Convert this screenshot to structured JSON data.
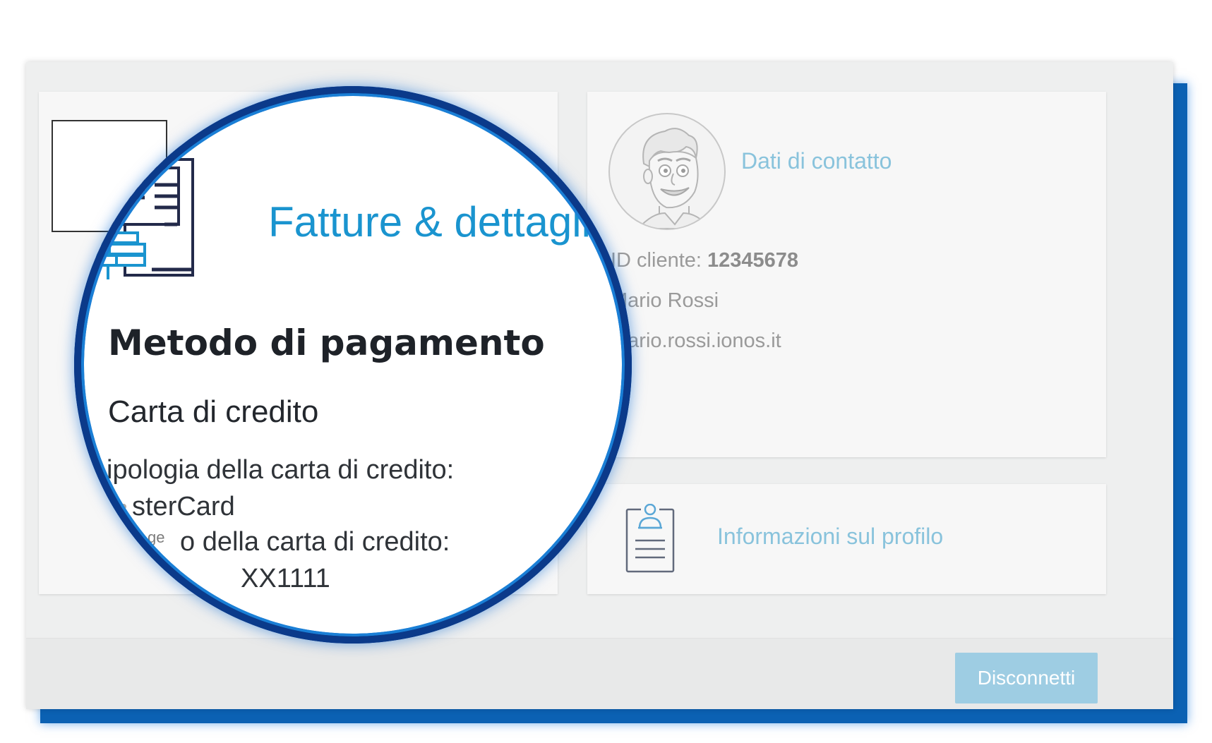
{
  "billing": {
    "title": "Fatture & dettagli",
    "payment_heading": "Metodo di pagamento",
    "payment_method": "Carta di credito",
    "card_type_label": "ipologia della carta di credito:",
    "card_type_value": "sterCard",
    "card_number_label": "o della carta di credito:",
    "card_number_label_prefix": "ge",
    "card_number_value": "XX1111"
  },
  "contact": {
    "title": "Dati di contatto",
    "customer_id_label": "ID cliente:",
    "customer_id_value": "12345678",
    "name": "Mario Rossi",
    "email": "mario.rossi.ionos.it"
  },
  "profile": {
    "title": "Informazioni sul profilo"
  },
  "footer": {
    "logout_label": "Disconnetti"
  },
  "colors": {
    "accent": "#1a94cf",
    "link_light": "#89c3dc",
    "button": "#9ecde3",
    "frame_blue": "#0b61b3"
  },
  "icons": {
    "invoice": "invoice-icon",
    "avatar": "user-avatar-icon",
    "profile": "profile-clipboard-icon"
  }
}
